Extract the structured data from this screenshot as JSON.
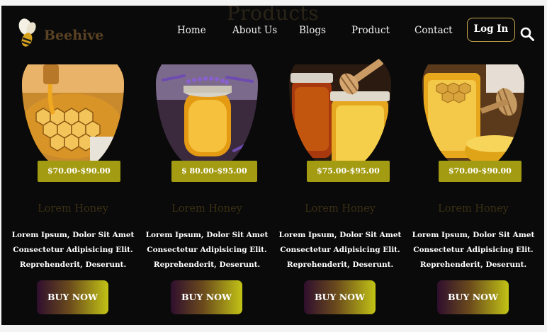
{
  "section": {
    "heading": "Products"
  },
  "brand": {
    "name": "Beehive",
    "icon": "bee-icon"
  },
  "nav": {
    "items": [
      "Home",
      "About Us",
      "Blogs",
      "Product",
      "Contact"
    ],
    "login_label": "Log In",
    "search_icon": "search-icon"
  },
  "colors": {
    "background": "#0a0a0a",
    "badge": "#a39b12",
    "button_gradient_start": "#2f0e2e",
    "button_gradient_end": "#c2c316",
    "login_border": "#c9a74a"
  },
  "products": [
    {
      "price": "$70.00-$90.00",
      "title": "Lorem Honey",
      "desc": [
        "Lorem Ipsum, Dolor Sit Amet",
        "Consectetur Adipisicing Elit.",
        "Reprehenderit, Deserunt."
      ],
      "button": "BUY NOW"
    },
    {
      "price": "$ 80.00-$95.00",
      "title": "Lorem Honey",
      "desc": [
        "Lorem Ipsum, Dolor Sit Amet",
        "Consectetur Adipisicing Elit.",
        "Reprehenderit, Deserunt."
      ],
      "button": "BUY NOW"
    },
    {
      "price": "$75.00-$95.00",
      "title": "Lorem Honey",
      "desc": [
        "Lorem Ipsum, Dolor Sit Amet",
        "Consectetur Adipisicing Elit.",
        "Reprehenderit, Deserunt."
      ],
      "button": "BUY NOW"
    },
    {
      "price": "$70.00-$90.00",
      "title": "Lorem Honey",
      "desc": [
        "Lorem Ipsum, Dolor Sit Amet",
        "Consectetur Adipisicing Elit.",
        "Reprehenderit, Deserunt."
      ],
      "button": "BUY NOW"
    }
  ]
}
